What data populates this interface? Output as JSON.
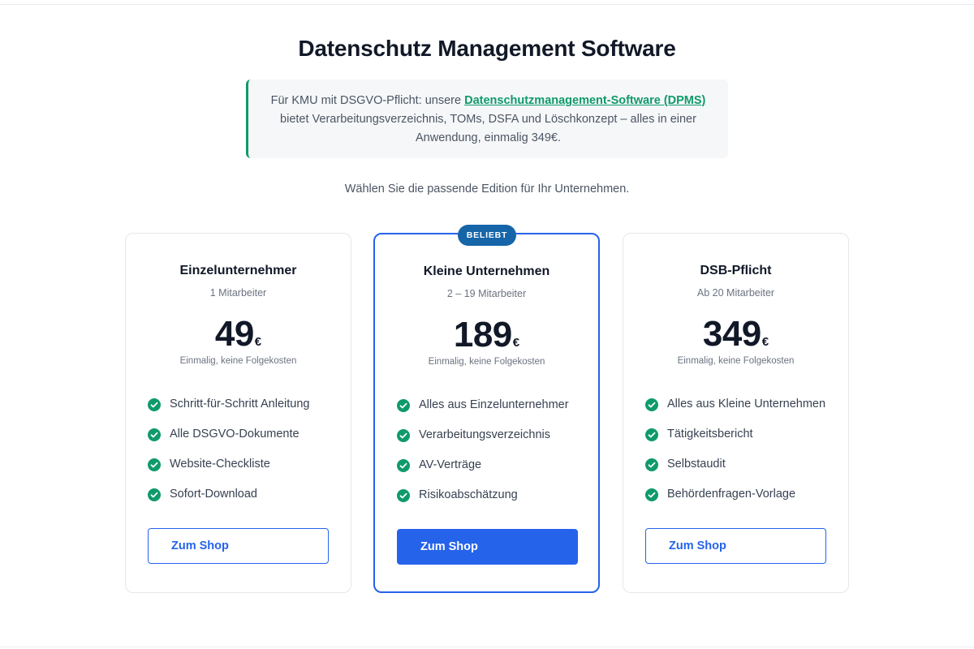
{
  "page": {
    "title": "Datenschutz Management Software",
    "intro": {
      "before": "Für KMU mit DSGVO-Pflicht: unsere ",
      "link": "Datenschutzmanagement-Software (DPMS)",
      "after": " bietet Verarbeitungsverzeichnis, TOMs, DSFA und Löschkonzept – alles in einer Anwendung, einmalig 349€."
    },
    "subtitle": "Wählen Sie die passende Edition für Ihr Unternehmen."
  },
  "colors": {
    "accent": "#2563eb",
    "check": "#0f9a6a",
    "badge": "#1565a8"
  },
  "plans": [
    {
      "name": "Einzelunternehmer",
      "employees": "1 Mitarbeiter",
      "price": "49",
      "currency": "€",
      "price_note": "Einmalig, keine Folgekosten",
      "features": [
        "Schritt-für-Schritt Anleitung",
        "Alle DSGVO-Dokumente",
        "Website-Checkliste",
        "Sofort-Download"
      ],
      "button": "Zum Shop"
    },
    {
      "badge": "BELIEBT",
      "name": "Kleine Unternehmen",
      "employees": "2 – 19 Mitarbeiter",
      "price": "189",
      "currency": "€",
      "price_note": "Einmalig, keine Folgekosten",
      "features": [
        "Alles aus Einzelunternehmer",
        "Verarbeitungsverzeichnis",
        "AV-Verträge",
        "Risikoabschätzung"
      ],
      "button": "Zum Shop"
    },
    {
      "name": "DSB-Pflicht",
      "employees": "Ab 20 Mitarbeiter",
      "price": "349",
      "currency": "€",
      "price_note": "Einmalig, keine Folgekosten",
      "features": [
        "Alles aus Kleine Unternehmen",
        "Tätigkeitsbericht",
        "Selbstaudit",
        "Behördenfragen-Vorlage"
      ],
      "button": "Zum Shop"
    }
  ]
}
